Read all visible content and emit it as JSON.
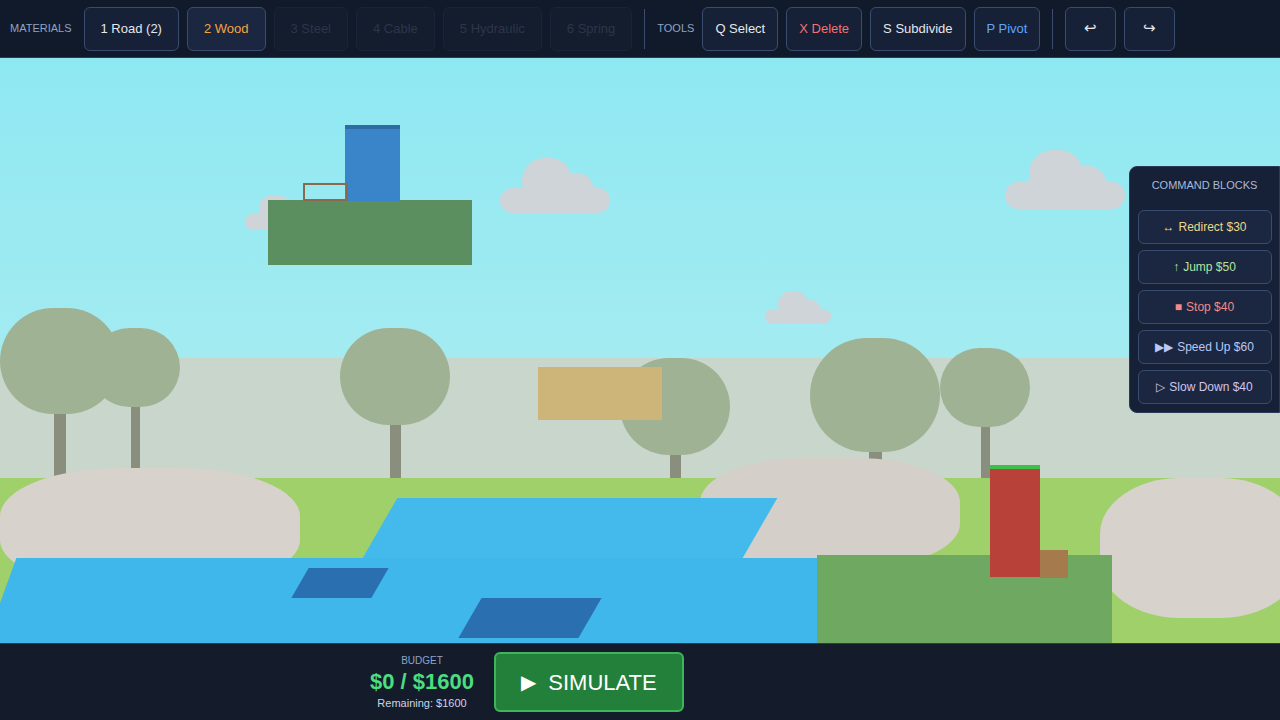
{
  "toolbar": {
    "materials_label": "MATERIALS",
    "materials": [
      {
        "label": "1 Road (2)",
        "selected": false,
        "disabled": false
      },
      {
        "label": "2 Wood",
        "selected": true,
        "disabled": false
      },
      {
        "label": "3 Steel",
        "selected": false,
        "disabled": true
      },
      {
        "label": "4 Cable",
        "selected": false,
        "disabled": true
      },
      {
        "label": "5 Hydraulic",
        "selected": false,
        "disabled": true
      },
      {
        "label": "6 Spring",
        "selected": false,
        "disabled": true
      }
    ],
    "tools_label": "TOOLS",
    "tools": [
      {
        "label": "Q Select",
        "color": "#e5e7eb"
      },
      {
        "label": "X Delete",
        "color": "#f87171"
      },
      {
        "label": "S Subdivide",
        "color": "#e5e7eb"
      },
      {
        "label": "P Pivot",
        "color": "#60a5fa"
      }
    ],
    "history": [
      {
        "label": "↩"
      },
      {
        "label": "↪"
      }
    ]
  },
  "command_blocks": {
    "title": "COMMAND BLOCKS",
    "items": [
      {
        "icon": "↔",
        "label": "Redirect $30",
        "color": "#e8d98a"
      },
      {
        "icon": "↑",
        "label": "Jump $50",
        "color": "#b5e3a0"
      },
      {
        "icon": "■",
        "label": "Stop $40",
        "color": "#f08a8a"
      },
      {
        "icon": "▶▶",
        "label": "Speed Up $60",
        "color": "#b9c8f5"
      },
      {
        "icon": "▷",
        "label": "Slow Down $40",
        "color": "#d0c4f0"
      }
    ]
  },
  "budget": {
    "label": "BUDGET",
    "value": "$0 / $1600",
    "remaining": "Remaining: $1600"
  },
  "simulate": {
    "icon": "▶",
    "label": "SIMULATE"
  }
}
